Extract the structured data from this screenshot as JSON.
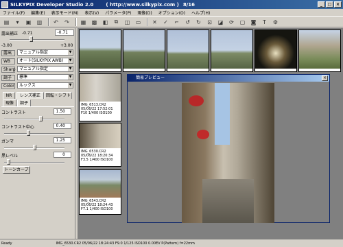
{
  "window": {
    "title": "SILKYPIX Developer Studio 2.0",
    "url": "( http://www.silkypix.com )",
    "counter": "8/16",
    "min_icon": "minimize-icon",
    "max_icon": "maximize-icon",
    "close_icon": "close-icon"
  },
  "menu": [
    "ファイル(F)",
    "編集(E)",
    "表示モード(M)",
    "表示(V)",
    "パラメータ(P)",
    "現像(D)",
    "オプション(O)",
    "ヘルプ(H)"
  ],
  "left": {
    "exposure_label": "露出補正",
    "exposure_value": "-0.71",
    "exposure_spin": "-0.71",
    "exposure_min": "-3.00",
    "exposure_max": "+3.00",
    "exposure_level": 0.38,
    "wb_group_label": "露出",
    "wb_group_value": "マニュアル指定",
    "wb_label": "WB",
    "wb_value": "オート(SILKYPIX AWB)",
    "sharp_label": "Sharp",
    "sharp_value": "マニュアル指定",
    "tone_label": "調子",
    "tone_value": "標準",
    "color_label": "Color",
    "color_value": "ルックス",
    "tabs": [
      "NR",
      "レンズ補正",
      "回転・シフト"
    ],
    "subtabs": [
      "現像",
      "調子"
    ],
    "contrast_label": "コントラスト",
    "contrast_value": "1.50",
    "contrast_level": 0.62,
    "contrast_center_label": "コントラスト中心",
    "contrast_center_value": "0.40",
    "contrast_center_level": 0.4,
    "gamma_label": "ガンマ",
    "gamma_value": "1.25",
    "gamma_level": 0.5,
    "black_label": "黒レベル",
    "black_value": "0",
    "black_level": 0.05,
    "tone_curve_button": "トーンカーブ"
  },
  "thumbs": {
    "row2": [
      {
        "file": "IMG_6513.CR2",
        "date": "05/06/22 17:52:01",
        "exif": "F10 1/400 ISO100"
      },
      {
        "file": "IMG_6530.CR2",
        "date": "05/06/22 18:20:34",
        "exif": "F3.5 1/400 ISO100"
      },
      {
        "file": "IMG_6543.CR2",
        "date": "05/06/22 18:24:43",
        "exif": "F7.1 1/400 ISO100"
      }
    ]
  },
  "preview": {
    "title": "簡易プレビュー",
    "close_icon": "close-icon"
  },
  "status": {
    "left": "Ready",
    "info": "IMG_6530.CR2 05/06/22 18:24:43 F9.0 1/125 ISO100 0.00EV P(Pattern) f=22mm"
  }
}
